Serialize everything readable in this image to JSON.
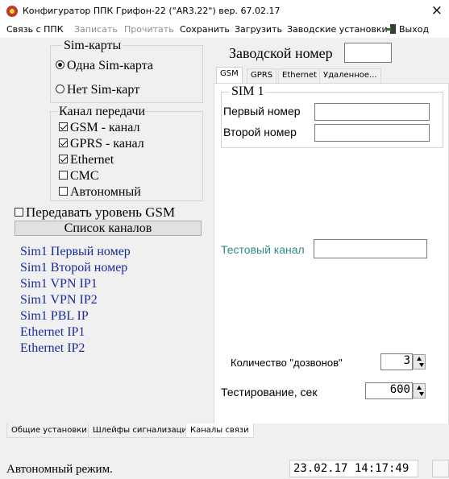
{
  "window": {
    "title": "Конфигуратор ППК Грифон-22 (\"AR3.22\") вер. 67.02.17",
    "close_glyph": "×"
  },
  "menu": {
    "items": [
      {
        "label": "Связь с ППК",
        "enabled": true
      },
      {
        "label": "Записать",
        "enabled": false
      },
      {
        "label": "Прочитать",
        "enabled": false
      },
      {
        "label": "Сохранить",
        "enabled": true
      },
      {
        "label": "Загрузить",
        "enabled": true
      },
      {
        "label": "Заводские установки",
        "enabled": true
      },
      {
        "label": "Выход",
        "enabled": true,
        "icon": "exit-door-icon"
      }
    ]
  },
  "sim_cards": {
    "title": "Sim-карты",
    "options": [
      {
        "label": "Одна Sim-карта",
        "selected": true
      },
      {
        "label": "Нет Sim-карт",
        "selected": false
      }
    ]
  },
  "channel": {
    "title": "Канал передачи",
    "options": [
      {
        "label": "GSM - канал",
        "checked": true
      },
      {
        "label": "GPRS - канал",
        "checked": true
      },
      {
        "label": "Ethernet",
        "checked": true
      },
      {
        "label": "СМС",
        "checked": false
      },
      {
        "label": "Автономный",
        "checked": false
      }
    ]
  },
  "gsm_level": {
    "label": "Передавать уровень GSM",
    "checked": false
  },
  "channels_button": {
    "label": "Список каналов"
  },
  "channel_list": [
    "Sim1 Первый номер",
    "Sim1 Второй номер",
    "Sim1 VPN IP1",
    "Sim1 VPN IP2",
    "Sim1 PBL IP",
    "Ethernet IP1",
    "Ethernet IP2"
  ],
  "factory_number": {
    "label": "Заводской номер",
    "value": ""
  },
  "right_tabs": {
    "items": [
      {
        "label": "GSM",
        "active": true
      },
      {
        "label": "GPRS",
        "active": false
      },
      {
        "label": "Ethernet",
        "active": false
      },
      {
        "label": "Удаленное...",
        "active": false
      }
    ]
  },
  "gsm_panel": {
    "sim_group_title": "SIM 1",
    "first_number": {
      "label": "Первый номер",
      "value": ""
    },
    "second_number": {
      "label": "Второй номер",
      "value": ""
    },
    "test_channel": {
      "label": "Тестовый канал",
      "value": ""
    },
    "dial_count": {
      "label": "Количество \"дозвонов\"",
      "value": "3"
    },
    "test_period": {
      "label": "Тестирование,  сек",
      "value": "600"
    }
  },
  "bottom_tabs": {
    "items": [
      {
        "label": "Общие установки",
        "active": false
      },
      {
        "label": "Шлейфы сигнализации",
        "active": false
      },
      {
        "label": "Каналы связи",
        "active": true
      }
    ]
  },
  "status": {
    "text": "Автономный режим.",
    "datetime": "23.02.17  14:17:49"
  },
  "colors": {
    "link": "#1a2a9c",
    "test_label": "#2e8b8b",
    "window_bg": "#f0f0f0"
  }
}
